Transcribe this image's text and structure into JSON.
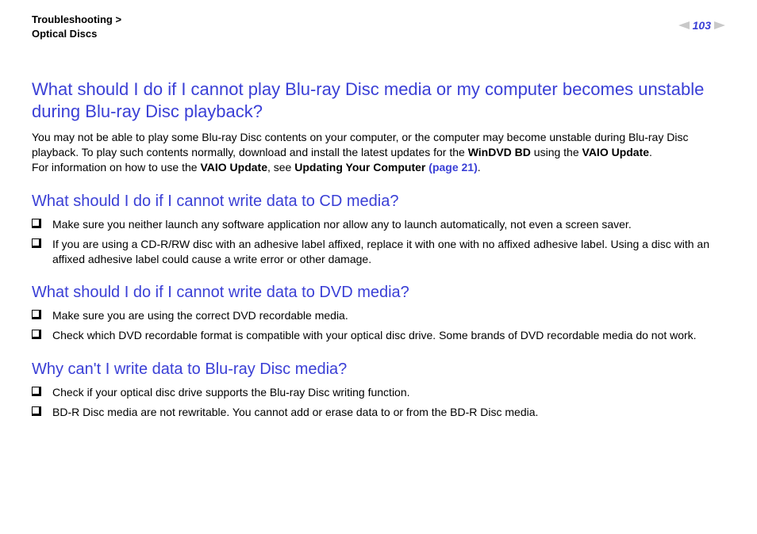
{
  "header": {
    "breadcrumb_parent": "Troubleshooting",
    "breadcrumb_sep": ">",
    "breadcrumb_child": "Optical Discs",
    "page_number": "103"
  },
  "section1": {
    "heading": "What should I do if I cannot play Blu-ray Disc media or my computer becomes unstable during Blu-ray Disc playback?",
    "para_a": "You may not be able to play some Blu-ray Disc contents on your computer, or the computer may become unstable during Blu-ray Disc playback. To play such contents normally, download and install the latest updates for the ",
    "bold_a": "WinDVD BD",
    "para_b": " using the ",
    "bold_b": "VAIO Update",
    "para_c": ".",
    "line2_a": "For information on how to use the ",
    "line2_bold_a": "VAIO Update",
    "line2_b": ", see ",
    "line2_bold_b": "Updating Your Computer ",
    "line2_link": "(page 21)",
    "line2_c": "."
  },
  "section2": {
    "heading": "What should I do if I cannot write data to CD media?",
    "items": [
      "Make sure you neither launch any software application nor allow any to launch automatically, not even a screen saver.",
      "If you are using a CD-R/RW disc with an adhesive label affixed, replace it with one with no affixed adhesive label. Using a disc with an affixed adhesive label could cause a write error or other damage."
    ]
  },
  "section3": {
    "heading": "What should I do if I cannot write data to DVD media?",
    "items": [
      "Make sure you are using the correct DVD recordable media.",
      "Check which DVD recordable format is compatible with your optical disc drive. Some brands of DVD recordable media do not work."
    ]
  },
  "section4": {
    "heading": "Why can't I write data to Blu-ray Disc media?",
    "items": [
      "Check if your optical disc drive supports the Blu-ray Disc writing function.",
      "BD-R Disc media are not rewritable. You cannot add or erase data to or from the BD-R Disc media."
    ]
  }
}
